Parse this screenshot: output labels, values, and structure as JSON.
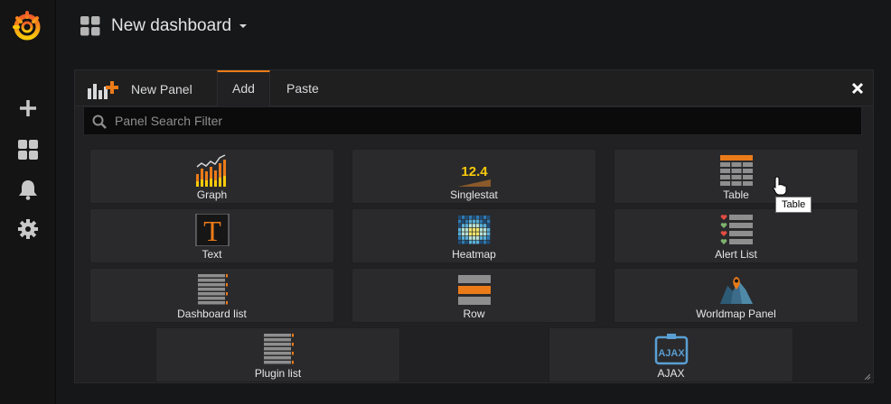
{
  "header": {
    "title": "New dashboard"
  },
  "sidebar": {
    "items": [
      {
        "icon": "plus-icon"
      },
      {
        "icon": "dashboards-icon"
      },
      {
        "icon": "bell-icon"
      },
      {
        "icon": "gear-icon"
      }
    ]
  },
  "panel": {
    "brand_label": "New Panel",
    "tabs": [
      {
        "label": "Add",
        "active": true
      },
      {
        "label": "Paste",
        "active": false
      }
    ],
    "search": {
      "placeholder": "Panel Search Filter",
      "value": ""
    },
    "cards": [
      {
        "label": "Graph"
      },
      {
        "label": "Singlestat",
        "icon_text": "12.4"
      },
      {
        "label": "Table"
      },
      {
        "label": "Text",
        "icon_text": "T"
      },
      {
        "label": "Heatmap"
      },
      {
        "label": "Alert List"
      },
      {
        "label": "Dashboard list"
      },
      {
        "label": "Row"
      },
      {
        "label": "Worldmap Panel"
      },
      {
        "label": "Plugin list"
      },
      {
        "label": "AJAX",
        "icon_text": "AJAX"
      }
    ],
    "tooltip": "Table"
  },
  "colors": {
    "accent": "#eb7b18",
    "background": "#161719",
    "card": "#2a2a2c"
  }
}
